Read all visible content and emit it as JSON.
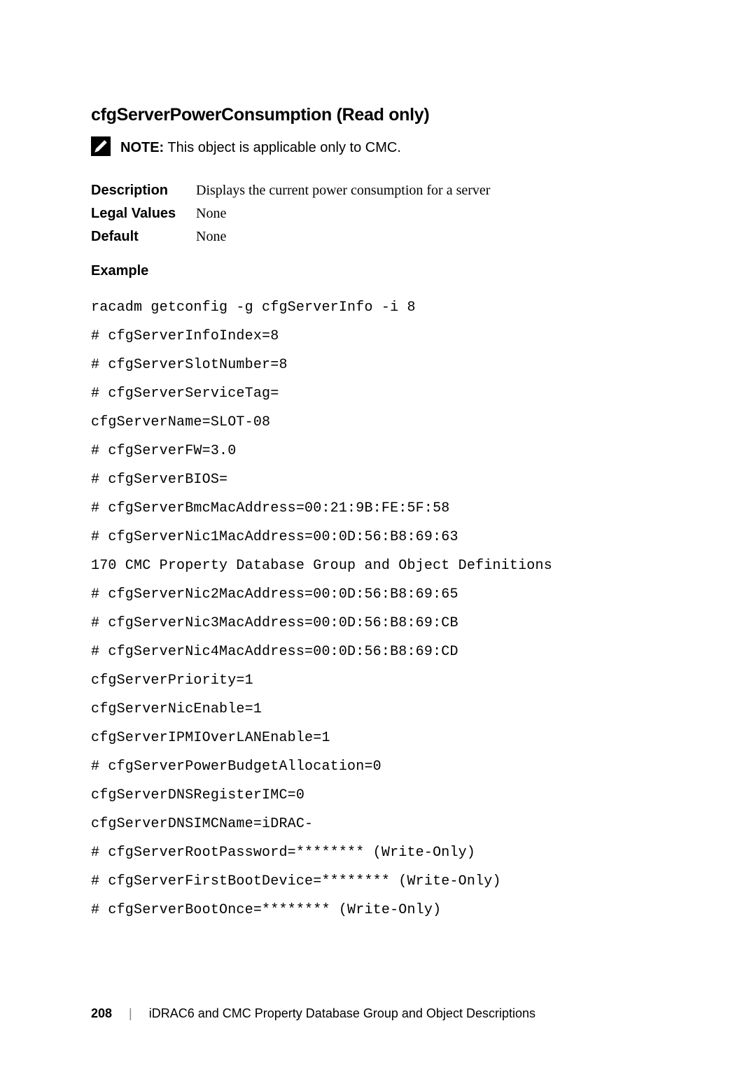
{
  "section": {
    "title": "cfgServerPowerConsumption (Read only)"
  },
  "note": {
    "label": "NOTE:",
    "text": " This object is applicable only to CMC."
  },
  "info": {
    "rows": [
      {
        "key": "Description",
        "val": "Displays the current power consumption for a server"
      },
      {
        "key": "Legal Values",
        "val": "None"
      },
      {
        "key": "Default",
        "val": "None"
      }
    ]
  },
  "example": {
    "label": "Example",
    "code": "racadm getconfig -g cfgServerInfo -i 8\n# cfgServerInfoIndex=8\n# cfgServerSlotNumber=8\n# cfgServerServiceTag= \ncfgServerName=SLOT-08\n# cfgServerFW=3.0\n# cfgServerBIOS= \n# cfgServerBmcMacAddress=00:21:9B:FE:5F:58\n# cfgServerNic1MacAddress=00:0D:56:B8:69:63\n170 CMC Property Database Group and Object Definitions\n# cfgServerNic2MacAddress=00:0D:56:B8:69:65\n# cfgServerNic3MacAddress=00:0D:56:B8:69:CB\n# cfgServerNic4MacAddress=00:0D:56:B8:69:CD\ncfgServerPriority=1\ncfgServerNicEnable=1\ncfgServerIPMIOverLANEnable=1\n# cfgServerPowerBudgetAllocation=0\ncfgServerDNSRegisterIMC=0\ncfgServerDNSIMCName=iDRAC-\n# cfgServerRootPassword=******** (Write-Only)\n# cfgServerFirstBootDevice=******** (Write-Only)\n# cfgServerBootOnce=******** (Write-Only)"
  },
  "footer": {
    "page": "208",
    "sep": "|",
    "title": "iDRAC6 and CMC Property Database Group and Object Descriptions"
  }
}
